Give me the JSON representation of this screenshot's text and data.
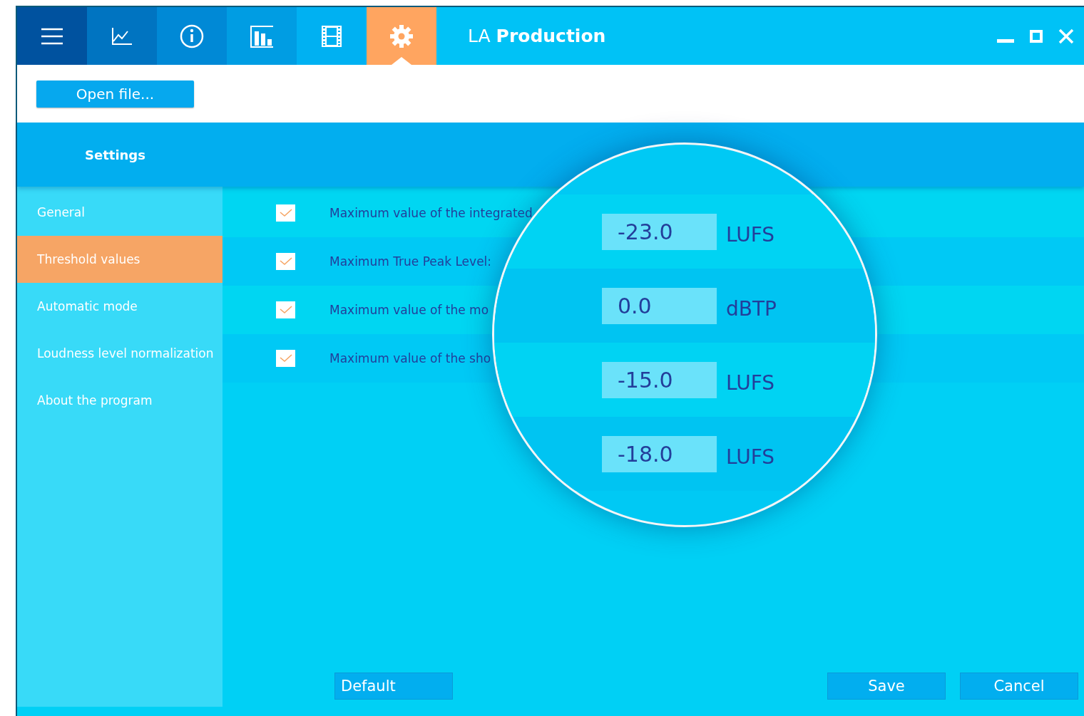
{
  "window": {
    "title": "LA **Production**"
  },
  "tabs": [
    {
      "kind": "menu",
      "selected": false
    },
    {
      "kind": "chart",
      "selected": false
    },
    {
      "kind": "info",
      "selected": false
    },
    {
      "kind": "bars",
      "selected": false
    },
    {
      "kind": "film",
      "selected": false
    },
    {
      "kind": "settings",
      "selected": true
    }
  ],
  "toolbar": {
    "open_button": "Open file..."
  },
  "section_title": "Settings",
  "sidebar": {
    "items": [
      {
        "label": "General",
        "selected": false
      },
      {
        "label": "Threshold values",
        "selected": true
      },
      {
        "label": "Automatic mode",
        "selected": false
      },
      {
        "label": "Loudness level normalization",
        "selected": false
      },
      {
        "label": "About the program",
        "selected": false
      }
    ]
  },
  "thresholds": [
    {
      "label": "Maximum value of the integrated",
      "checked": true
    },
    {
      "label": "Maximum True Peak Level:",
      "checked": true
    },
    {
      "label": "Maximum value of the mo",
      "checked": true
    },
    {
      "label": "Maximum value of the sho",
      "checked": true
    }
  ],
  "magnifier": {
    "rows": [
      {
        "value": "-23.0",
        "unit": "LUFS"
      },
      {
        "value": "0.0",
        "unit": "dBTP"
      },
      {
        "value": "-15.0",
        "unit": "LUFS"
      },
      {
        "value": "-18.0",
        "unit": "LUFS"
      }
    ]
  },
  "footer": {
    "default_button": "Default",
    "save_button": "Save",
    "cancel_button": "Cancel"
  }
}
